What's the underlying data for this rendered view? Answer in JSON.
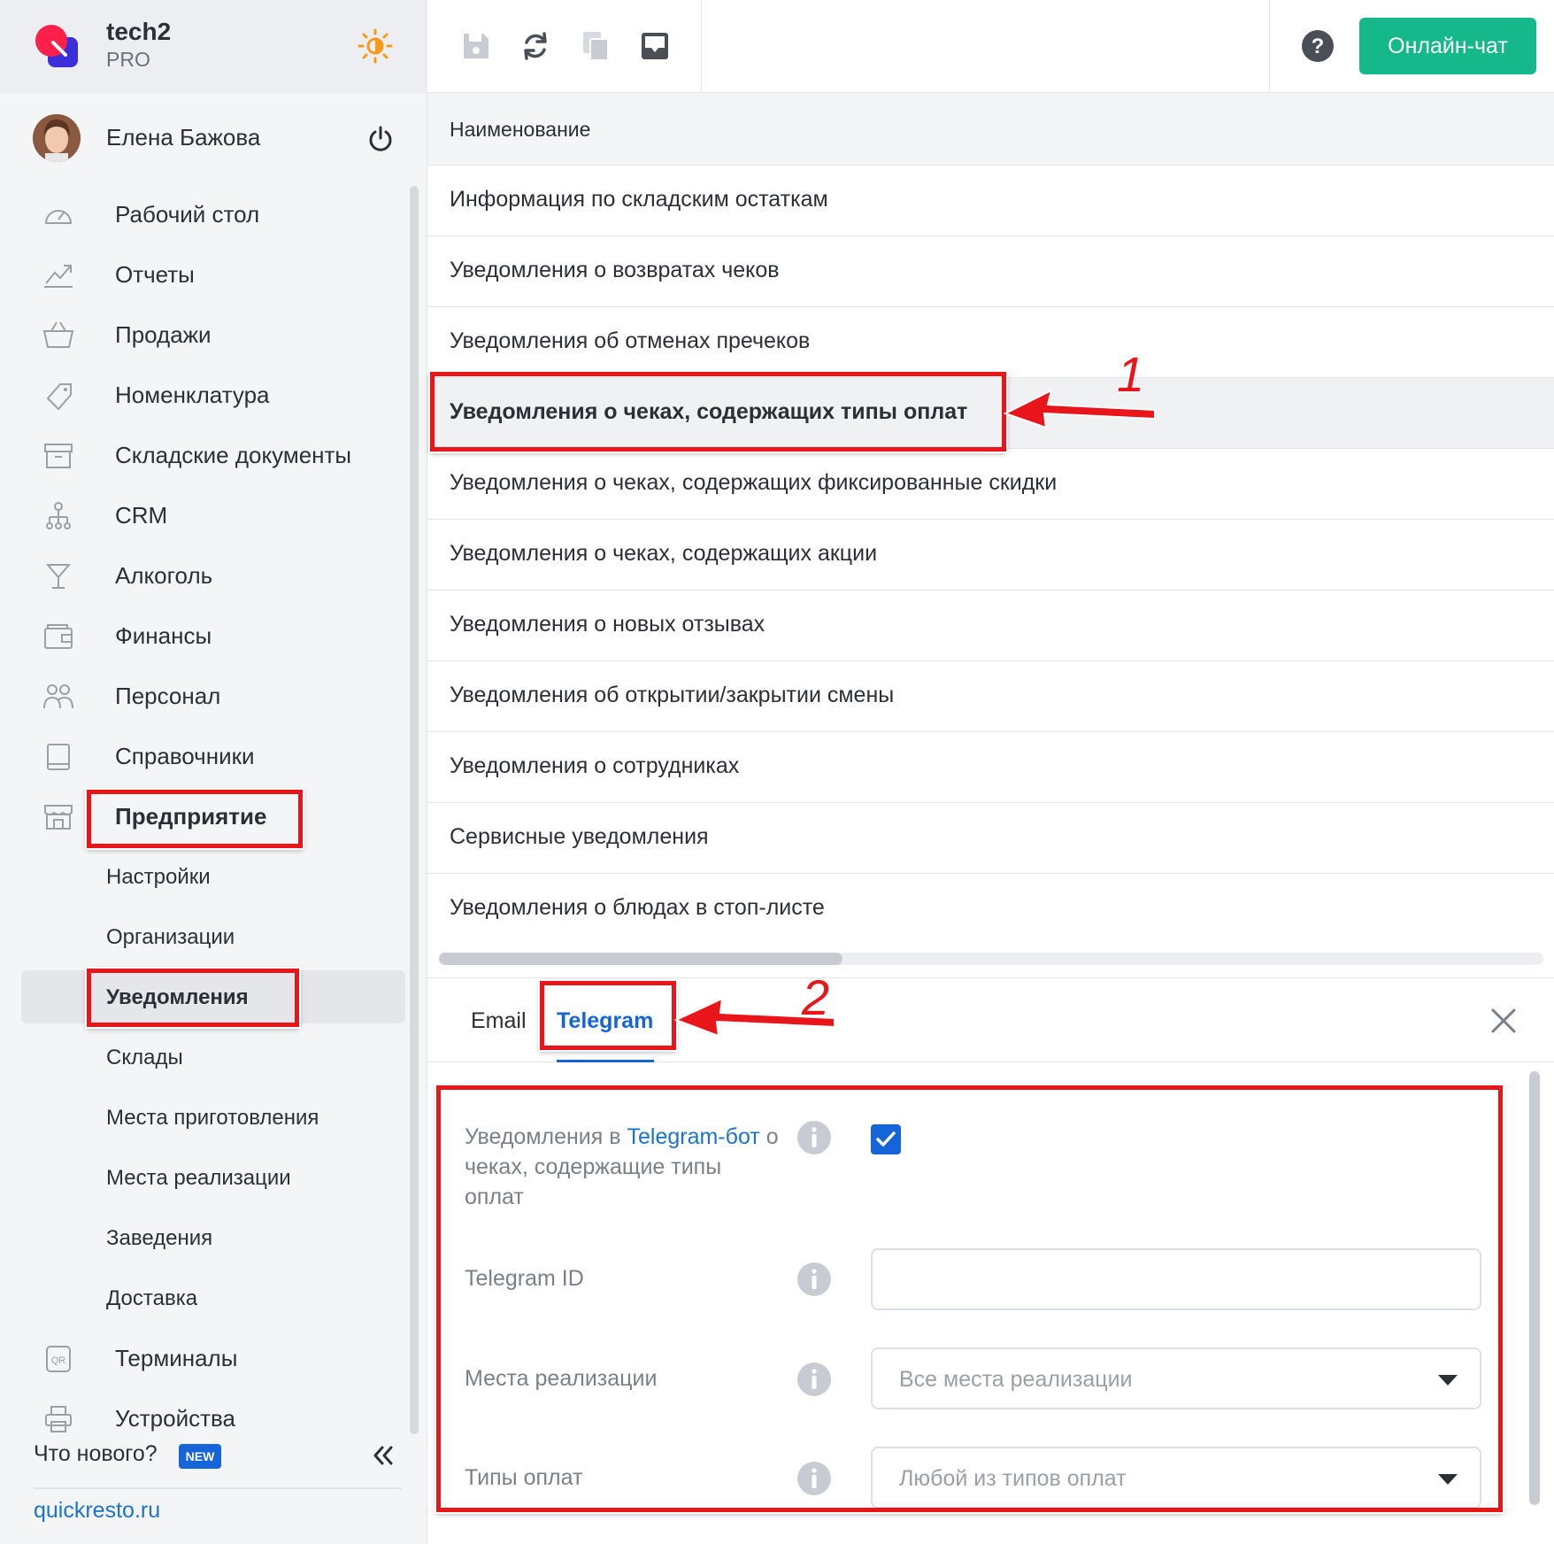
{
  "brand": {
    "name": "tech2",
    "plan": "PRO"
  },
  "user": {
    "name": "Елена Бажова"
  },
  "sidebar": {
    "menu": [
      {
        "label": "Рабочий стол",
        "icon": "dashboard-icon"
      },
      {
        "label": "Отчеты",
        "icon": "reports-icon"
      },
      {
        "label": "Продажи",
        "icon": "basket-icon"
      },
      {
        "label": "Номенклатура",
        "icon": "tag-icon"
      },
      {
        "label": "Складские документы",
        "icon": "archive-icon"
      },
      {
        "label": "CRM",
        "icon": "crm-icon"
      },
      {
        "label": "Алкоголь",
        "icon": "cocktail-icon"
      },
      {
        "label": "Финансы",
        "icon": "wallet-icon"
      },
      {
        "label": "Персонал",
        "icon": "staff-icon"
      },
      {
        "label": "Справочники",
        "icon": "book-icon"
      },
      {
        "label": "Предприятие",
        "icon": "store-icon"
      }
    ],
    "submenu": [
      {
        "label": "Настройки"
      },
      {
        "label": "Организации"
      },
      {
        "label": "Уведомления"
      },
      {
        "label": "Склады"
      },
      {
        "label": "Места приготовления"
      },
      {
        "label": "Места реализации"
      },
      {
        "label": "Заведения"
      },
      {
        "label": "Доставка"
      }
    ],
    "menu_after": [
      {
        "label": "Терминалы",
        "icon": "qr-icon"
      },
      {
        "label": "Устройства",
        "icon": "printer-icon"
      }
    ],
    "whats_new": "Что нового?",
    "new_badge": "NEW",
    "site_link": "quickresto.ru"
  },
  "toolbar": {
    "chat_button": "Онлайн-чат"
  },
  "list": {
    "header": "Наименование",
    "rows": [
      "Информация по складским остаткам",
      "Уведомления о возвратах чеков",
      "Уведомления об отменах пречеков",
      "Уведомления о чеках, содержащих типы оплат",
      "Уведомления о чеках, содержащих фиксированные скидки",
      "Уведомления о чеках, содержащих акции",
      "Уведомления о новых отзывах",
      "Уведомления об открытии/закрытии смены",
      "Уведомления о сотрудниках",
      "Сервисные уведомления",
      "Уведомления о блюдах в стоп-листе"
    ],
    "selected_index": 3
  },
  "panel": {
    "tabs": [
      "Email",
      "Telegram"
    ],
    "active_tab": "Telegram",
    "fields": {
      "notify_label_pre": "Уведомления в ",
      "notify_label_link": "Telegram-бот",
      "notify_label_post": " о чеках, содержащие типы оплат",
      "notify_checked": true,
      "telegram_id_label": "Telegram ID",
      "telegram_id_value": "",
      "places_label": "Места реализации",
      "places_value": "Все места реализации",
      "payment_label": "Типы оплат",
      "payment_value": "Любой из типов оплат"
    }
  },
  "annotations": {
    "step1": "1",
    "step2": "2"
  },
  "colors": {
    "accent": "#1665d8",
    "chat": "#14b88a",
    "annotation": "#e8151b"
  }
}
